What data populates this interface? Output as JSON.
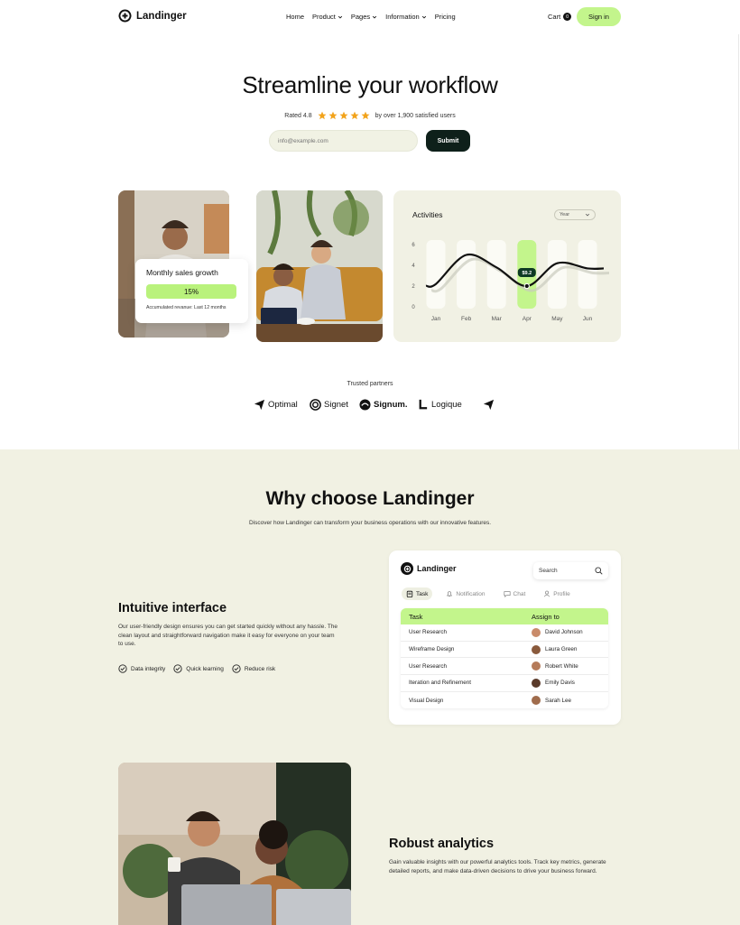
{
  "nav": {
    "brand": "Landinger",
    "links": [
      {
        "label": "Home",
        "dropdown": false
      },
      {
        "label": "Product",
        "dropdown": true
      },
      {
        "label": "Pages",
        "dropdown": true
      },
      {
        "label": "Information",
        "dropdown": true
      },
      {
        "label": "Pricing",
        "dropdown": false
      }
    ],
    "cart_label": "Cart",
    "cart_count": "0",
    "signin_label": "Sign in"
  },
  "hero": {
    "title": "Streamline your workflow",
    "rating_prefix": "Rated 4.8",
    "rating_stars": 5,
    "rating_suffix": "by over 1,900 satisfied users",
    "email_placeholder": "info@example.com",
    "submit_label": "Submit"
  },
  "sales_card": {
    "title": "Monthly sales growth",
    "value": "15%",
    "subtitle": "Accumulated revanue: Last 12 months"
  },
  "chart": {
    "title": "Activities",
    "select_value": "Year"
  },
  "chart_data": {
    "type": "line",
    "title": "Activities",
    "categories": [
      "Jan",
      "Feb",
      "Mar",
      "Apr",
      "May",
      "Jun"
    ],
    "yticks": [
      0,
      2,
      4,
      6
    ],
    "ylim": [
      0,
      6
    ],
    "series": [
      {
        "values": [
          2.2,
          5.0,
          3.8,
          2.0,
          4.2,
          3.7
        ]
      }
    ],
    "highlight": {
      "category": "Apr",
      "label": "$9.2"
    },
    "grid": false
  },
  "partners": {
    "label": "Trusted partners",
    "items": [
      "Optimal",
      "Signet",
      "Signum.",
      "Logique",
      ""
    ]
  },
  "why": {
    "title": "Why choose Landinger",
    "subtitle": "Discover how Landinger can transform your business operations with our innovative features."
  },
  "intuitive": {
    "title": "Intuitive interface",
    "body": "Our user-friendly design ensures you can get started quickly without any hassle. The clean layout and straightforward navigation make it easy for everyone on your team to use.",
    "features": [
      "Data integrity",
      "Quick learning",
      "Reduce risk"
    ]
  },
  "app": {
    "brand": "Landinger",
    "search_placeholder": "Search",
    "tabs": [
      "Task",
      "Notification",
      "Chat",
      "Profile"
    ],
    "columns": [
      "Task",
      "Assign to"
    ],
    "rows": [
      {
        "task": "User Research",
        "assignee": "David Johnson",
        "color": "#c98b6a"
      },
      {
        "task": "Wireframe Design",
        "assignee": "Laura Green",
        "color": "#8a5a3c"
      },
      {
        "task": "User Research",
        "assignee": "Robert White",
        "color": "#b57b5a"
      },
      {
        "task": "Iteration and Refinement",
        "assignee": "Emily Davis",
        "color": "#5a3a2a"
      },
      {
        "task": "Visual Design",
        "assignee": "Sarah Lee",
        "color": "#a06c4c"
      }
    ]
  },
  "analytics": {
    "title": "Robust analytics",
    "body": "Gain valuable insights with our powerful analytics tools. Track key metrics, generate detailed reports, and make data-driven decisions to drive your business forward."
  },
  "colors": {
    "accent": "#c3f58c",
    "dark": "#0e201a",
    "section_bg": "#f1f1e3",
    "star": "#f2a31b"
  }
}
